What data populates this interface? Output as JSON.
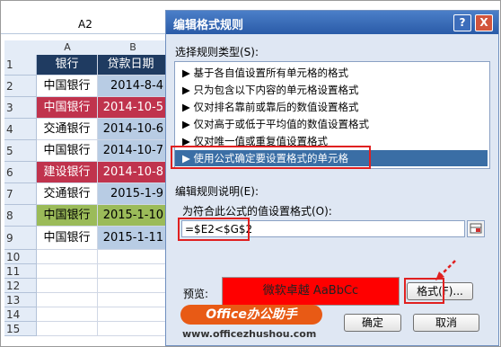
{
  "sheet": {
    "name_box": "A2",
    "col_headers": [
      "A",
      "B"
    ],
    "header_row": {
      "a": "银行",
      "b": "贷款日期"
    },
    "rows": [
      {
        "num": "2",
        "bank": "中国银行",
        "date": "2014-8-4",
        "color": "#b8cce4"
      },
      {
        "num": "3",
        "bank": "中国银行",
        "date": "2014-10-5",
        "color": "#c0334d"
      },
      {
        "num": "4",
        "bank": "交通银行",
        "date": "2014-10-6",
        "color": "#b8cce4"
      },
      {
        "num": "5",
        "bank": "中国银行",
        "date": "2014-10-7",
        "color": "#b8cce4"
      },
      {
        "num": "6",
        "bank": "建设银行",
        "date": "2014-10-8",
        "color": "#c0334d"
      },
      {
        "num": "7",
        "bank": "交通银行",
        "date": "2015-1-9",
        "color": "#b8cce4"
      },
      {
        "num": "8",
        "bank": "中国银行",
        "date": "2015-1-10",
        "color": "#9bbb59"
      },
      {
        "num": "9",
        "bank": "中国银行",
        "date": "2015-1-11",
        "color": "#b8cce4"
      }
    ],
    "empty_rows": [
      "10",
      "11",
      "12",
      "13",
      "14",
      "15"
    ],
    "header_row_num": "1"
  },
  "dialog": {
    "title": "编辑格式规则",
    "help_btn": "?",
    "close_btn": "X",
    "rule_type_label": "选择规则类型(S):",
    "rule_types": [
      "▶  基于各自值设置所有单元格的格式",
      "▶  只为包含以下内容的单元格设置格式",
      "▶  仅对排名靠前或靠后的数值设置格式",
      "▶  仅对高于或低于平均值的数值设置格式",
      "▶  仅对唯一值或重复值设置格式",
      "▶  使用公式确定要设置格式的单元格"
    ],
    "edit_desc_label": "编辑规则说明(E):",
    "formula_label": "为符合此公式的值设置格式(O):",
    "formula_value": "=$E2<$G$2",
    "preview_label": "预览:",
    "preview_text": "微软卓越  AaBbCc",
    "format_btn": "格式(F)...",
    "ok_btn": "确定",
    "cancel_btn": "取消"
  },
  "watermark": {
    "text": "Office办公助手",
    "url": "www.officezhushou.com"
  }
}
